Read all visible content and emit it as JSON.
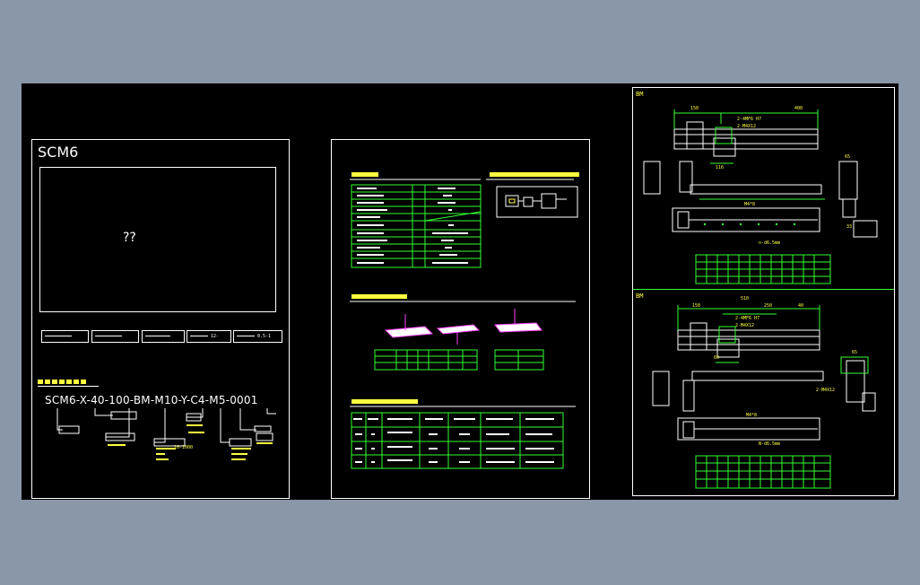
{
  "panel_left": {
    "title": "SCM6",
    "preview_placeholder": "??",
    "option_boxes": [
      "12-",
      "0.5-1"
    ],
    "model_code": "SCM6-X-40-100-BM-M10-Y-C4-M5-0001",
    "callouts": [
      "10-1000"
    ]
  },
  "panel_right": {
    "section_bm_top": "BM",
    "section_bm_bottom": "BM",
    "dimensions_top": [
      "150",
      "400",
      "2-4MF6 H7",
      "2-M4X12",
      "116",
      "M4*8",
      "n-d6.5mm",
      "33",
      "65"
    ],
    "dimensions_bottom": [
      "510",
      "150",
      "250",
      "40",
      "2-4MF6 H7",
      "2-M4X12",
      "65",
      "60",
      "2-M4X12",
      "M4*8",
      "N-d6.5mm"
    ]
  },
  "colors": {
    "background": "#8a97a8",
    "sheet": "#000000",
    "frame": "#ffffff",
    "accent_green": "#33ff33",
    "accent_yellow": "#ffff40",
    "accent_cyan": "#22ffff",
    "accent_magenta": "#ff40ff"
  }
}
